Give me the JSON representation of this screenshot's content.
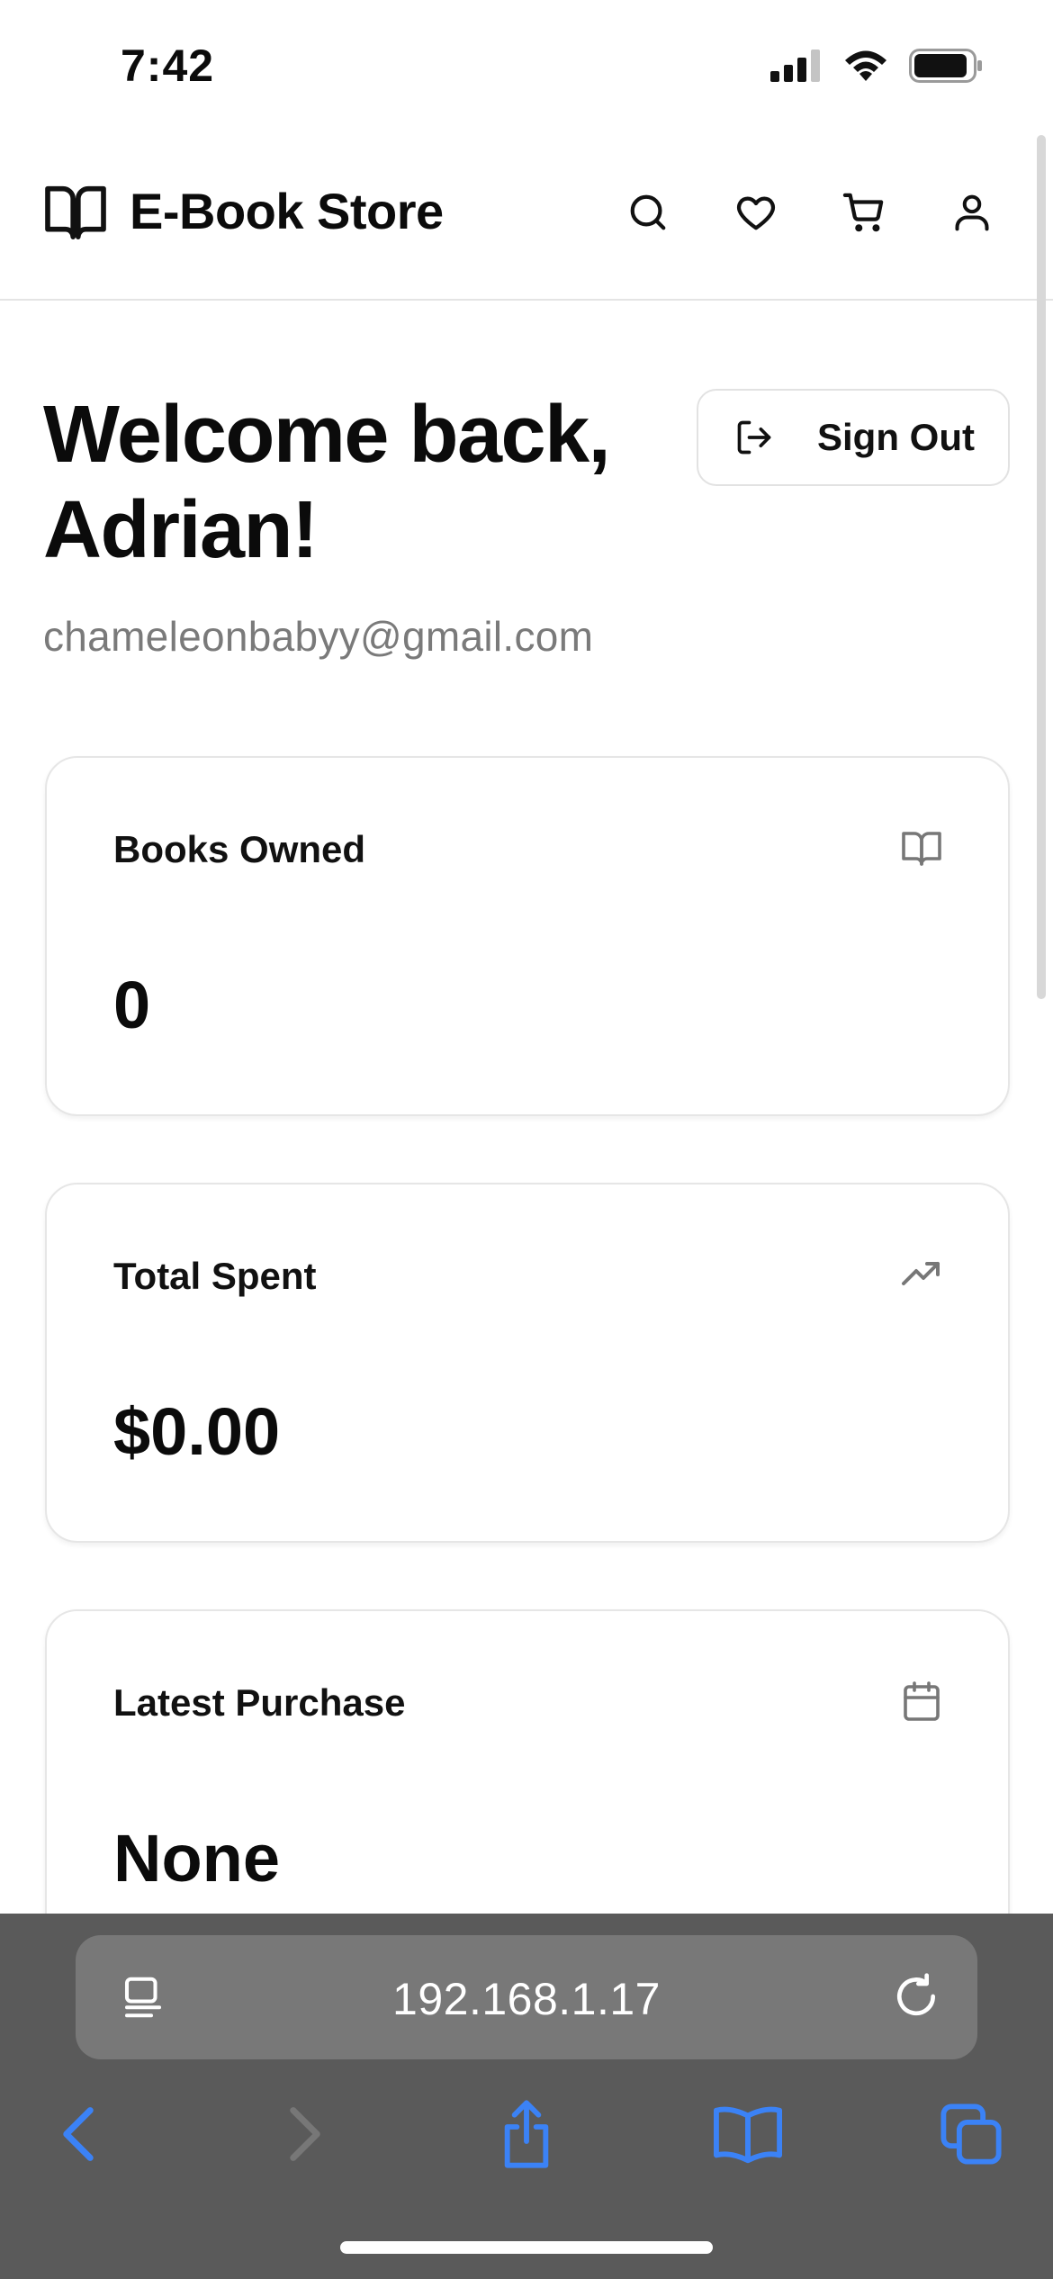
{
  "status_bar": {
    "time": "7:42"
  },
  "header": {
    "brand_title": "E-Book Store",
    "icons": [
      "book-open-icon",
      "search-icon",
      "heart-icon",
      "cart-icon",
      "user-icon"
    ]
  },
  "welcome": {
    "title_line1": "Welcome back,",
    "title_line2": "Adrian!",
    "email": "chameleonbabyy@gmail.com",
    "sign_out_label": "Sign Out"
  },
  "stats": [
    {
      "label": "Books Owned",
      "value": "0",
      "icon": "book-open-icon"
    },
    {
      "label": "Total Spent",
      "value": "$0.00",
      "icon": "trending-up-icon"
    },
    {
      "label": "Latest Purchase",
      "value": "None",
      "icon": "calendar-icon"
    }
  ],
  "browser": {
    "url": "192.168.1.17",
    "toolbar_icons": [
      "back-icon",
      "forward-icon",
      "share-icon",
      "bookmarks-icon",
      "tabs-icon"
    ],
    "accent_color": "#3b82f6"
  }
}
